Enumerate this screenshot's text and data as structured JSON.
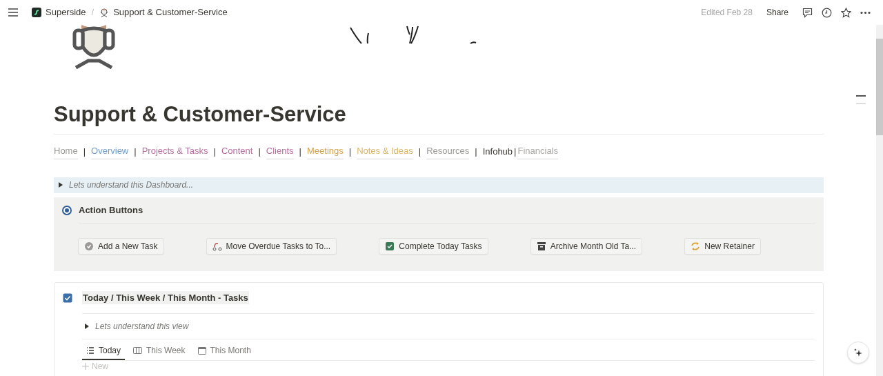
{
  "topbar": {
    "breadcrumbs": [
      {
        "label": "Superside",
        "kind": "workspace"
      },
      {
        "label": "Support & Customer-Service",
        "kind": "page"
      }
    ],
    "separator": "/",
    "edited": "Edited Feb 28",
    "share": "Share"
  },
  "page": {
    "title": "Support & Customer-Service",
    "nav": [
      {
        "label": "Home",
        "color": "#9b9a97",
        "underlined": true,
        "separator": "|"
      },
      {
        "label": "Overview",
        "color": "#6f9ccc",
        "underlined": true,
        "separator": "|"
      },
      {
        "label": "Projects & Tasks",
        "color": "#b86fa0",
        "underlined": true,
        "separator": "|"
      },
      {
        "label": "Content",
        "color": "#b86fa0",
        "underlined": true,
        "separator": "|"
      },
      {
        "label": "Clients",
        "color": "#b86fa0",
        "underlined": true,
        "separator": "|"
      },
      {
        "label": "Meetings",
        "color": "#d2a24c",
        "underlined": true,
        "separator": "|"
      },
      {
        "label": "Notes & Ideas",
        "color": "#d9b566",
        "underlined": true,
        "separator": "|"
      },
      {
        "label": "Resources",
        "color": "#9b9a97",
        "underlined": true,
        "separator": "|"
      },
      {
        "label": "Infohub",
        "color": "#37352f",
        "underlined": false,
        "separator": "|"
      },
      {
        "label": "Financials",
        "color": "#a8a7a4",
        "underlined": true
      }
    ],
    "dashboard_toggle": {
      "label": "Lets understand this Dashboard...",
      "expanded": false
    },
    "action_section": {
      "title": "Action Buttons",
      "buttons": [
        {
          "label": "Add a New Task",
          "kind": "check-circle"
        },
        {
          "label": "Move Overdue Tasks to To...",
          "kind": "route"
        },
        {
          "label": "Complete Today Tasks",
          "kind": "check-box"
        },
        {
          "label": "Archive Month Old Ta...",
          "kind": "archive"
        },
        {
          "label": "New Retainer",
          "kind": "refresh"
        }
      ]
    },
    "tasks_section": {
      "title": "Today / This Week / This Month - Tasks",
      "checked": true,
      "toggle": {
        "label": "Lets understand this view",
        "expanded": false
      },
      "tabs": [
        {
          "label": "Today",
          "kind": "list",
          "selected": true
        },
        {
          "label": "This Week",
          "kind": "board",
          "selected": false
        },
        {
          "label": "This Month",
          "kind": "calendar",
          "selected": false
        }
      ],
      "new_label": "New"
    }
  }
}
